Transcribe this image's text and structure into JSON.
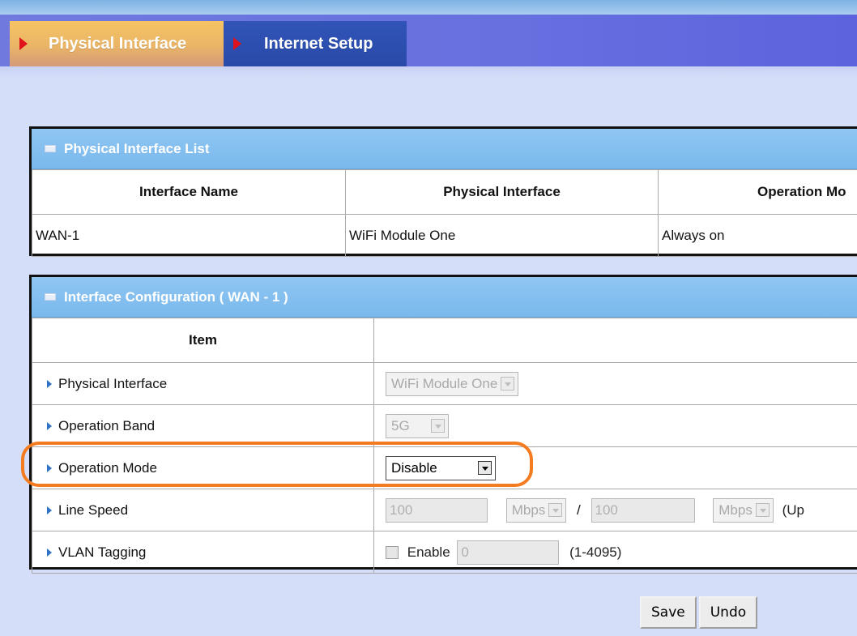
{
  "tabs": [
    {
      "label": "Physical Interface",
      "active": true
    },
    {
      "label": "Internet Setup",
      "active": false
    }
  ],
  "list_panel": {
    "title": "Physical Interface List",
    "columns": [
      "Interface Name",
      "Physical Interface",
      "Operation Mo"
    ],
    "rows": [
      [
        "WAN-1",
        "WiFi Module One",
        "Always on"
      ]
    ]
  },
  "config_panel": {
    "title": "Interface Configuration ( WAN - 1 )",
    "item_header": "Item",
    "rows": {
      "physical_interface": {
        "label": "Physical Interface",
        "value": "WiFi Module One"
      },
      "operation_band": {
        "label": "Operation Band",
        "value": "5G"
      },
      "operation_mode": {
        "label": "Operation Mode",
        "value": "Disable"
      },
      "line_speed": {
        "label": "Line Speed",
        "down_value": "100",
        "down_unit": "Mbps",
        "separator": "/",
        "up_value": "100",
        "up_unit": "Mbps",
        "suffix": "(Up"
      },
      "vlan_tagging": {
        "label": "VLAN Tagging",
        "checkbox_label": "Enable",
        "value": "0",
        "range": "(1-4095)"
      }
    }
  },
  "buttons": {
    "save": "Save",
    "undo": "Undo"
  },
  "colors": {
    "highlight": "#f47b20",
    "header_blue": "#7ab8ec",
    "active_tab": "#eab566",
    "inactive_tab": "#2a4aa8"
  }
}
